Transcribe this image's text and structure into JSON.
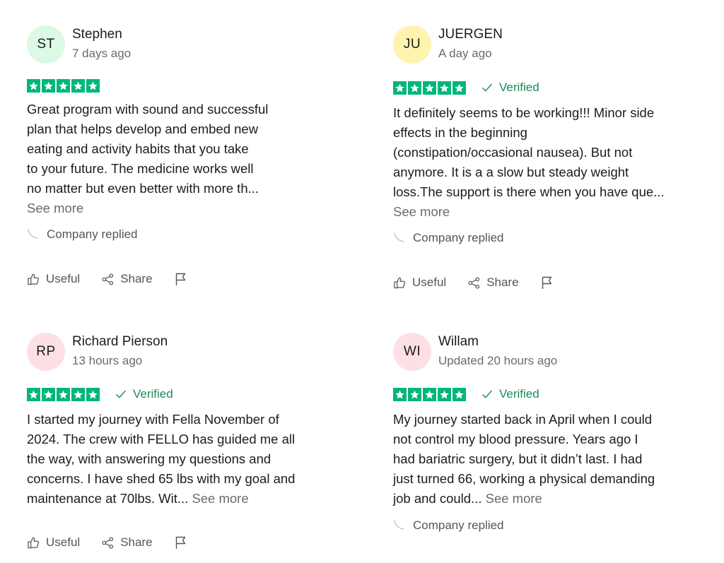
{
  "reviews": [
    {
      "initials": "ST",
      "avatar_color": "#dcf9e3",
      "name": "Stephen",
      "date": "7 days ago",
      "stars": 5,
      "verified": false,
      "lines": [
        "Great program with sound and successful",
        "plan that helps develop and embed new",
        "eating and activity habits that you take",
        "to your future. The medicine works well",
        "no matter but even better with more th..."
      ],
      "see_more_inline": false,
      "see_more": "See more",
      "company_replied": "Company replied",
      "useful": "Useful",
      "share": "Share",
      "flag_icon": "flag-icon"
    },
    {
      "initials": "JU",
      "avatar_color": "#fff3b0",
      "name": "JUERGEN",
      "date": "A day ago",
      "stars": 5,
      "verified": true,
      "verified_label": "Verified",
      "lines": [
        "It definitely seems to be working!!! Minor side",
        "effects in the beginning",
        "(constipation/occasional nausea). But not",
        "anymore. It is a a slow but steady weight",
        "loss.The support is there when you have que..."
      ],
      "see_more_inline": false,
      "see_more": "See more",
      "company_replied": "Company replied",
      "useful": "Useful",
      "share": "Share",
      "flag_icon": "flag-icon"
    },
    {
      "initials": "RP",
      "avatar_color": "#fde0e6",
      "name": "Richard Pierson",
      "date": "13 hours ago",
      "stars": 5,
      "verified": true,
      "verified_label": "Verified",
      "lines": [
        "I started my journey with Fella November of",
        "2024. The crew with FELLO has guided me all",
        "the way, with answering my questions and",
        "concerns. I have shed 65 lbs with my goal and",
        "maintenance at 70lbs. Wit..."
      ],
      "see_more_inline": true,
      "see_more": "See more",
      "useful": "Useful",
      "share": "Share",
      "flag_icon": "flag-icon"
    },
    {
      "initials": "WI",
      "avatar_color": "#fde0e6",
      "name": "Willam",
      "date": "Updated 20 hours ago",
      "stars": 5,
      "verified": true,
      "verified_label": "Verified",
      "lines": [
        "My journey started back in April when I could",
        "not control my blood pressure. Years ago I",
        "had bariatric surgery, but it didn’t last. I had",
        "just turned 66, working a physical demanding",
        "job and could..."
      ],
      "see_more_inline": true,
      "see_more": "See more",
      "company_replied": "Company replied"
    }
  ]
}
